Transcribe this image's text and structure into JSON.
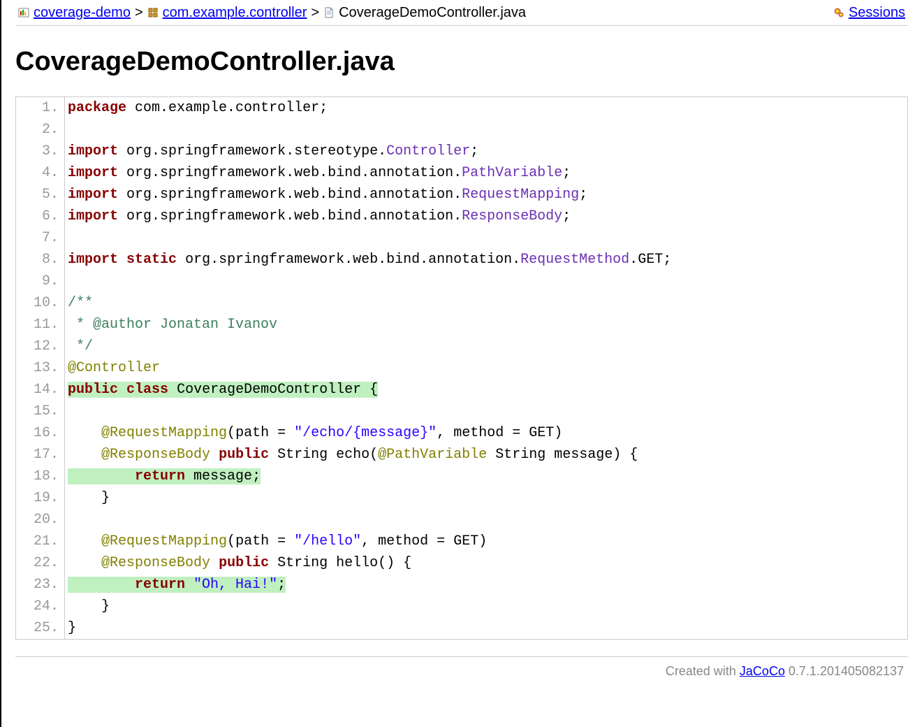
{
  "breadcrumb": {
    "item1": {
      "label": "coverage-demo"
    },
    "item2": {
      "label": "com.example.controller"
    },
    "current": {
      "label": "CoverageDemoController.java"
    },
    "sep": ">",
    "sessions_label": "Sessions"
  },
  "title": "CoverageDemoController.java",
  "source": {
    "lines": [
      {
        "n": "1.",
        "cov": "none",
        "segments": [
          [
            "kw",
            "package"
          ],
          [
            "sp",
            " "
          ],
          [
            "pkg",
            "com.example.controller"
          ],
          [
            "punc",
            ";"
          ]
        ]
      },
      {
        "n": "2.",
        "cov": "none",
        "segments": []
      },
      {
        "n": "3.",
        "cov": "none",
        "segments": [
          [
            "kw",
            "import"
          ],
          [
            "sp",
            " "
          ],
          [
            "pkg",
            "org.springframework.stereotype."
          ],
          [
            "member",
            "Controller"
          ],
          [
            "punc",
            ";"
          ]
        ]
      },
      {
        "n": "4.",
        "cov": "none",
        "segments": [
          [
            "kw",
            "import"
          ],
          [
            "sp",
            " "
          ],
          [
            "pkg",
            "org.springframework.web.bind.annotation."
          ],
          [
            "member",
            "PathVariable"
          ],
          [
            "punc",
            ";"
          ]
        ]
      },
      {
        "n": "5.",
        "cov": "none",
        "segments": [
          [
            "kw",
            "import"
          ],
          [
            "sp",
            " "
          ],
          [
            "pkg",
            "org.springframework.web.bind.annotation."
          ],
          [
            "member",
            "RequestMapping"
          ],
          [
            "punc",
            ";"
          ]
        ]
      },
      {
        "n": "6.",
        "cov": "none",
        "segments": [
          [
            "kw",
            "import"
          ],
          [
            "sp",
            " "
          ],
          [
            "pkg",
            "org.springframework.web.bind.annotation."
          ],
          [
            "member",
            "ResponseBody"
          ],
          [
            "punc",
            ";"
          ]
        ]
      },
      {
        "n": "7.",
        "cov": "none",
        "segments": []
      },
      {
        "n": "8.",
        "cov": "none",
        "segments": [
          [
            "kw",
            "import"
          ],
          [
            "sp",
            " "
          ],
          [
            "kw",
            "static"
          ],
          [
            "sp",
            " "
          ],
          [
            "pkg",
            "org.springframework.web.bind.annotation."
          ],
          [
            "member",
            "RequestMethod"
          ],
          [
            "punc",
            "."
          ],
          [
            "ident",
            "GET"
          ],
          [
            "punc",
            ";"
          ]
        ]
      },
      {
        "n": "9.",
        "cov": "none",
        "segments": []
      },
      {
        "n": "10.",
        "cov": "none",
        "segments": [
          [
            "cmt",
            "/**"
          ]
        ]
      },
      {
        "n": "11.",
        "cov": "none",
        "segments": [
          [
            "cmt",
            " * @author Jonatan Ivanov"
          ]
        ]
      },
      {
        "n": "12.",
        "cov": "none",
        "segments": [
          [
            "cmt",
            " */"
          ]
        ]
      },
      {
        "n": "13.",
        "cov": "none",
        "segments": [
          [
            "ann",
            "@Controller"
          ]
        ]
      },
      {
        "n": "14.",
        "cov": "full-inline",
        "segments": [
          [
            "mark_start"
          ],
          [
            "kw",
            "public"
          ],
          [
            "sp",
            " "
          ],
          [
            "kw",
            "class"
          ],
          [
            "sp",
            " "
          ],
          [
            "ident",
            "CoverageDemoController "
          ],
          [
            "punc",
            "{"
          ],
          [
            "mark_end"
          ]
        ]
      },
      {
        "n": "15.",
        "cov": "none",
        "segments": []
      },
      {
        "n": "16.",
        "cov": "none",
        "segments": [
          [
            "indent",
            "    "
          ],
          [
            "ann",
            "@RequestMapping"
          ],
          [
            "punc",
            "("
          ],
          [
            "ident",
            "path "
          ],
          [
            "op",
            "="
          ],
          [
            "sp",
            " "
          ],
          [
            "str",
            "\"/echo/{message}\""
          ],
          [
            "punc",
            ","
          ],
          [
            "sp",
            " "
          ],
          [
            "ident",
            "method "
          ],
          [
            "op",
            "="
          ],
          [
            "sp",
            " "
          ],
          [
            "ident",
            "GET"
          ],
          [
            "punc",
            ")"
          ]
        ]
      },
      {
        "n": "17.",
        "cov": "none",
        "segments": [
          [
            "indent",
            "    "
          ],
          [
            "ann",
            "@ResponseBody"
          ],
          [
            "sp",
            " "
          ],
          [
            "kw",
            "public"
          ],
          [
            "sp",
            " "
          ],
          [
            "ident",
            "String echo"
          ],
          [
            "punc",
            "("
          ],
          [
            "ann",
            "@PathVariable"
          ],
          [
            "sp",
            " "
          ],
          [
            "ident",
            "String message"
          ],
          [
            "punc",
            ")"
          ],
          [
            "sp",
            " "
          ],
          [
            "punc",
            "{"
          ]
        ]
      },
      {
        "n": "18.",
        "cov": "full",
        "segments": [
          [
            "indent",
            "        "
          ],
          [
            "kw",
            "return"
          ],
          [
            "sp",
            " "
          ],
          [
            "ident",
            "message"
          ],
          [
            "punc",
            ";"
          ]
        ]
      },
      {
        "n": "19.",
        "cov": "none",
        "segments": [
          [
            "indent",
            "    "
          ],
          [
            "punc",
            "}"
          ]
        ]
      },
      {
        "n": "20.",
        "cov": "none",
        "segments": []
      },
      {
        "n": "21.",
        "cov": "none",
        "segments": [
          [
            "indent",
            "    "
          ],
          [
            "ann",
            "@RequestMapping"
          ],
          [
            "punc",
            "("
          ],
          [
            "ident",
            "path "
          ],
          [
            "op",
            "="
          ],
          [
            "sp",
            " "
          ],
          [
            "str",
            "\"/hello\""
          ],
          [
            "punc",
            ","
          ],
          [
            "sp",
            " "
          ],
          [
            "ident",
            "method "
          ],
          [
            "op",
            "="
          ],
          [
            "sp",
            " "
          ],
          [
            "ident",
            "GET"
          ],
          [
            "punc",
            ")"
          ]
        ]
      },
      {
        "n": "22.",
        "cov": "none",
        "segments": [
          [
            "indent",
            "    "
          ],
          [
            "ann",
            "@ResponseBody"
          ],
          [
            "sp",
            " "
          ],
          [
            "kw",
            "public"
          ],
          [
            "sp",
            " "
          ],
          [
            "ident",
            "String hello"
          ],
          [
            "punc",
            "()"
          ],
          [
            "sp",
            " "
          ],
          [
            "punc",
            "{"
          ]
        ]
      },
      {
        "n": "23.",
        "cov": "full",
        "segments": [
          [
            "indent",
            "        "
          ],
          [
            "kw",
            "return"
          ],
          [
            "sp",
            " "
          ],
          [
            "str",
            "\"Oh, Hai!\""
          ],
          [
            "punc",
            ";"
          ]
        ]
      },
      {
        "n": "24.",
        "cov": "none",
        "segments": [
          [
            "indent",
            "    "
          ],
          [
            "punc",
            "}"
          ]
        ]
      },
      {
        "n": "25.",
        "cov": "none",
        "segments": [
          [
            "punc",
            "}"
          ]
        ]
      }
    ]
  },
  "footer": {
    "text_prefix": "Created with ",
    "link_label": "JaCoCo",
    "text_suffix": " 0.7.1.201405082137"
  },
  "colors": {
    "coverage_full": "#c0f0c0",
    "keyword": "#880000",
    "annotation": "#808000",
    "string": "#2A00FF",
    "comment": "#3F7F5F",
    "member": "#6b2fb3"
  }
}
